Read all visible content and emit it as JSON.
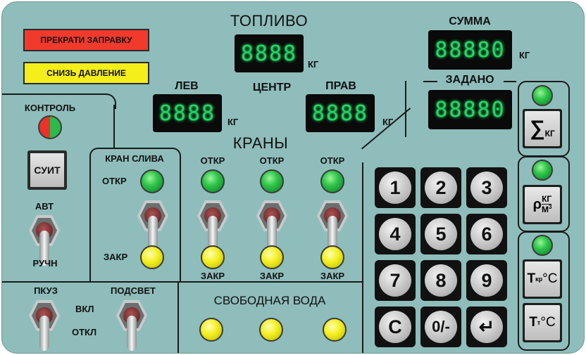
{
  "warnings": {
    "stop_fueling": {
      "label": "ПРЕКРАТИ ЗАПРАВКУ",
      "color": "#f23a2c"
    },
    "reduce_pressure": {
      "label": "СНИЗЬ ДАВЛЕНИЕ",
      "color": "#f4ee1a"
    }
  },
  "fuel": {
    "title": "ТОПЛИВО",
    "center": {
      "label": "ЦЕНТР",
      "value": "8888",
      "unit": "КГ"
    },
    "left": {
      "label": "ЛЕВ",
      "value": "8888",
      "unit": "КГ"
    },
    "right": {
      "label": "ПРАВ",
      "value": "8888",
      "unit": "КГ"
    }
  },
  "sum": {
    "label": "СУММА",
    "value": "88880",
    "unit": "КГ"
  },
  "set": {
    "label": "ЗАДАНО",
    "value": "88880"
  },
  "valves": {
    "title": "КРАНЫ",
    "open_label": "ОТКР",
    "closed_label": "ЗАКР",
    "drain": {
      "title": "КРАН СЛИВА",
      "open": "ОТКР",
      "closed": "ЗАКР"
    }
  },
  "control": {
    "label": "КОНТРОЛЬ",
    "colors": [
      "#e8322a",
      "#2fb84a"
    ]
  },
  "suit_button": "СУИТ",
  "mode": {
    "auto": "АВТ",
    "manual": "РУЧН"
  },
  "pkuz": {
    "label": "ПКУЗ"
  },
  "backlight": {
    "label": "ПОДСВЕТ",
    "on": "ВКЛ",
    "off": "ОТКЛ"
  },
  "free_water": {
    "title": "СВОБОДНАЯ ВОДА"
  },
  "keypad": {
    "keys": [
      "1",
      "2",
      "3",
      "4",
      "5",
      "6",
      "7",
      "8",
      "9",
      "C",
      "0/-",
      "↵"
    ]
  },
  "functions": {
    "sum_kg": {
      "symbol": "∑",
      "sub": "КГ"
    },
    "density": {
      "rho": "ρ",
      "num": "КГ",
      "den": "М",
      "exp": "3"
    },
    "temp_kr": {
      "t": "Т",
      "sub": "кр",
      "unit": "°C"
    },
    "temp_t": {
      "t": "Т",
      "sub": "т",
      "unit": "°C"
    }
  }
}
